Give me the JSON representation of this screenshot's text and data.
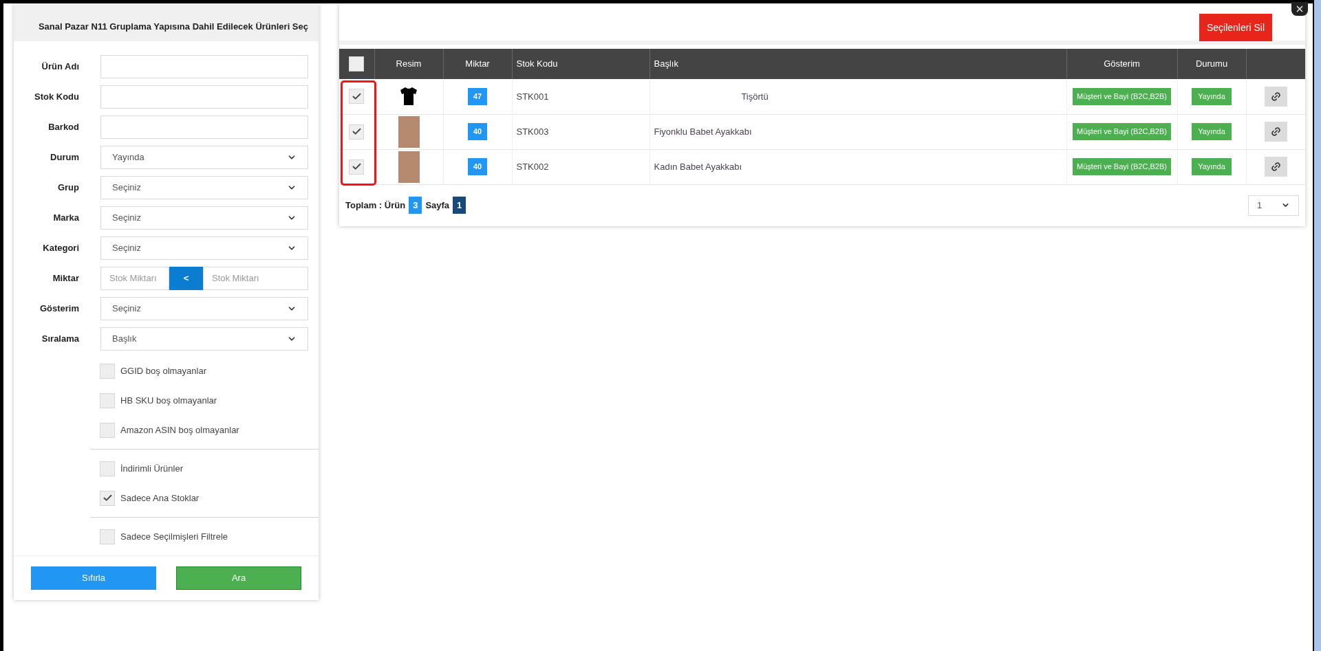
{
  "dialog_title": "Sanal Pazar N11 Gruplama Yapısına Dahil Edilecek Ürünleri Seç",
  "filters": [
    {
      "kind": "text",
      "label": "Ürün Adı"
    },
    {
      "kind": "text",
      "label": "Stok Kodu"
    },
    {
      "kind": "text",
      "label": "Barkod"
    },
    {
      "kind": "select",
      "label": "Durum",
      "value": "Yayında"
    },
    {
      "kind": "select",
      "label": "Grup",
      "value": "Seçiniz"
    },
    {
      "kind": "select",
      "label": "Marka",
      "value": "Seçiniz"
    },
    {
      "kind": "select",
      "label": "Kategori",
      "value": "Seçiniz"
    },
    {
      "kind": "range",
      "label": "Miktar",
      "from": {
        "placeholder": "Stok Miktarı"
      },
      "operator": "<",
      "to": {
        "placeholder": "Stok Miktarı"
      }
    },
    {
      "kind": "select",
      "label": "Gösterim",
      "value": "Seçiniz"
    },
    {
      "kind": "select",
      "label": "Sıralama",
      "value": "Başlık"
    }
  ],
  "option_groups": [
    [
      {
        "label": "GGID boş olmayanlar",
        "checked": false
      },
      {
        "label": "HB SKU boş olmayanlar",
        "checked": false
      },
      {
        "label": "Amazon ASIN boş olmayanlar",
        "checked": false
      }
    ],
    [
      {
        "label": "İndirimli Ürünler",
        "checked": false
      },
      {
        "label": "Sadece Ana Stoklar",
        "checked": true
      }
    ],
    [
      {
        "label": "Sadece Seçilmişleri Filtrele",
        "checked": false
      }
    ]
  ],
  "buttons": [
    {
      "kind": "reset",
      "label": "Sıfırla"
    },
    {
      "kind": "search",
      "label": "Ara"
    }
  ],
  "delete_button": "Seçilenleri Sil",
  "table": {
    "select_all_checked": false,
    "highlight_checkboxes": true,
    "columns": [
      "Resim",
      "Miktar",
      "Stok Kodu",
      "Başlık",
      "Gösterim",
      "Durumu"
    ],
    "rows": [
      {
        "checked": true,
        "kind": "tshirt",
        "quantity": "47",
        "stock_code": "STK001",
        "title": "Tişörtü",
        "title_centered": true,
        "visibility": "Müşteri ve Bayi (B2C,B2B)",
        "status": "Yayında"
      },
      {
        "checked": true,
        "kind": "photo",
        "quantity": "40",
        "stock_code": "STK003",
        "title": "Fiyonklu Babet Ayakkabı",
        "title_centered": false,
        "visibility": "Müşteri ve Bayi (B2C,B2B)",
        "status": "Yayında"
      },
      {
        "checked": true,
        "kind": "photo",
        "quantity": "40",
        "stock_code": "STK002",
        "title": "Kadın Babet Ayakkabı",
        "title_centered": false,
        "visibility": "Müşteri ve Bayi (B2C,B2B)",
        "status": "Yayında"
      }
    ]
  },
  "footer": {
    "total_label": "Toplam : Ürün",
    "total_count": "3",
    "page_label": "Sayfa",
    "page_count": "1",
    "page_select": "1"
  }
}
